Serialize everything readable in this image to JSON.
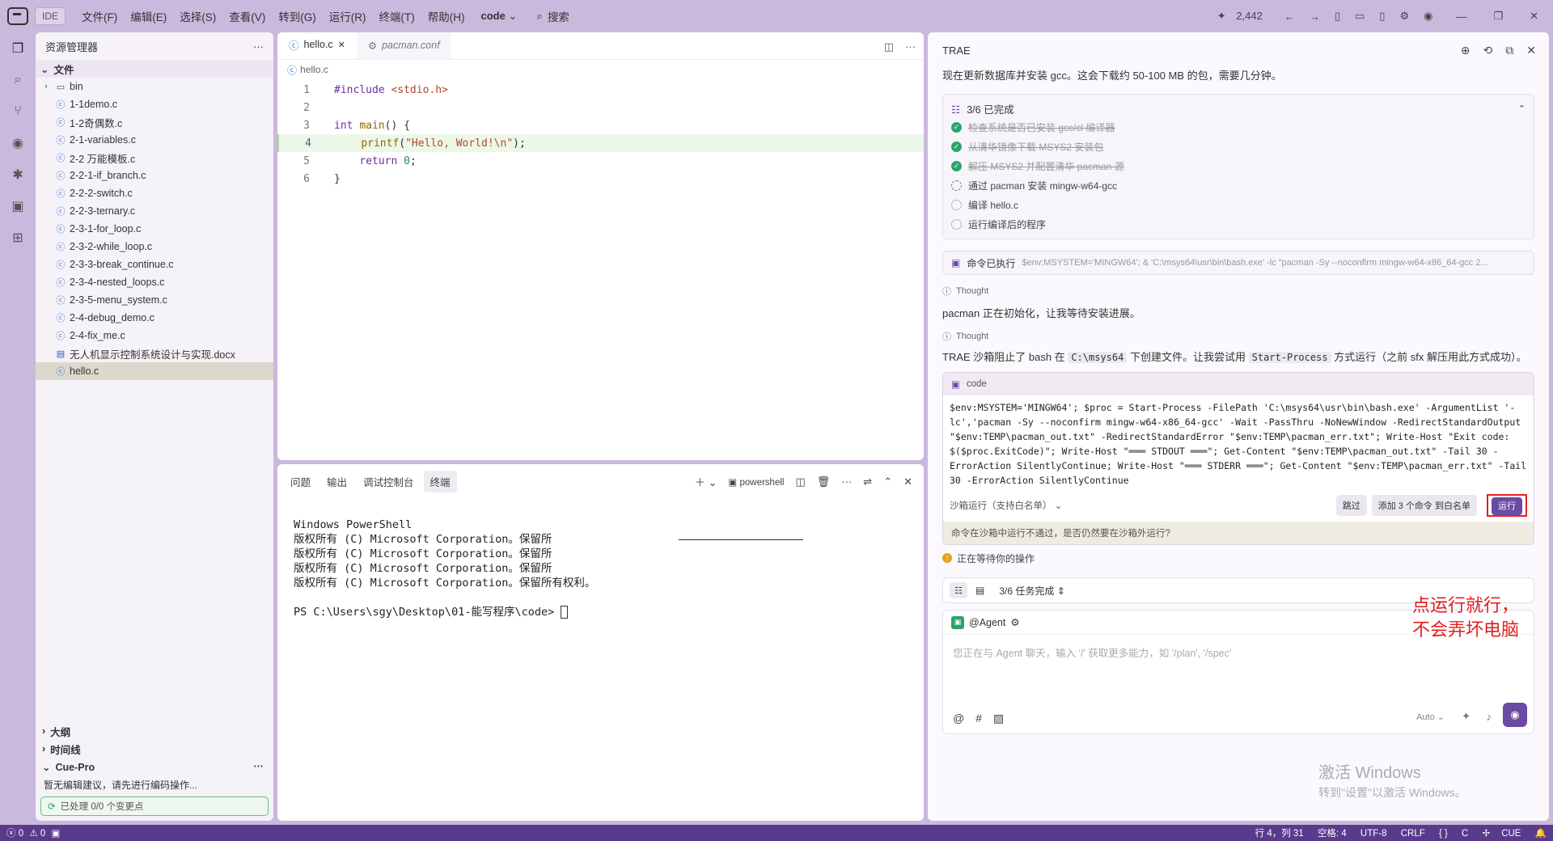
{
  "titlebar": {
    "ide_badge": "IDE",
    "menu": [
      "文件(F)",
      "编辑(E)",
      "选择(S)",
      "查看(V)",
      "转到(G)",
      "运行(R)",
      "终端(T)",
      "帮助(H)"
    ],
    "project": "code",
    "search": "搜索",
    "count": "2,442"
  },
  "explorer": {
    "title": "资源管理器",
    "section": "文件",
    "folder": "bin",
    "files": [
      "1-1demo.c",
      "1-2奇偶数.c",
      "2-1-variables.c",
      "2-2 万能模板.c",
      "2-2-1-if_branch.c",
      "2-2-2-switch.c",
      "2-2-3-ternary.c",
      "2-3-1-for_loop.c",
      "2-3-2-while_loop.c",
      "2-3-3-break_continue.c",
      "2-3-4-nested_loops.c",
      "2-3-5-menu_system.c",
      "2-4-debug_demo.c",
      "2-4-fix_me.c"
    ],
    "docx": "无人机显示控制系统设计与实现.docx",
    "selected_file": "hello.c",
    "outline": "大纲",
    "timeline": "时间线",
    "cue_title": "Cue-Pro",
    "cue_text": "暂无编辑建议，请先进行编码操作...",
    "cue_status": "已处理 0/0 个变更点"
  },
  "editor": {
    "tabs": [
      "hello.c",
      "pacman.conf"
    ],
    "breadcrumb": "hello.c",
    "lines": [
      {
        "n": "1",
        "code": "#include <stdio.h>"
      },
      {
        "n": "2",
        "code": ""
      },
      {
        "n": "3",
        "code": "int main() {"
      },
      {
        "n": "4",
        "code": "    printf(\"Hello, World!\\n\");"
      },
      {
        "n": "5",
        "code": "    return 0;"
      },
      {
        "n": "6",
        "code": "}"
      }
    ]
  },
  "panel": {
    "tabs": [
      "问题",
      "输出",
      "调试控制台",
      "终端"
    ],
    "shell": "powershell",
    "terminal_lines": [
      "Windows PowerShell",
      "版权所有 (C) Microsoft Corporation。保留所",
      "版权所有 (C) Microsoft Corporation。保留所",
      "版权所有 (C) Microsoft Corporation。保留所",
      "版权所有 (C) Microsoft Corporation。保留所有权利。",
      "",
      "PS C:\\Users\\sgy\\Desktop\\01-能写程序\\code> "
    ]
  },
  "chat": {
    "title": "TRAE",
    "intro": "现在更新数据库并安装 gcc。这会下载约 50-100 MB 的包，需要几分钟。",
    "task_progress": "3/6 已完成",
    "tasks": [
      {
        "text": "检查系统是否已安装 gcc/cl 编译器",
        "state": "done"
      },
      {
        "text": "从清华镜像下载 MSYS2 安装包",
        "state": "done"
      },
      {
        "text": "解压 MSYS2 并配置清华 pacman 源",
        "state": "done"
      },
      {
        "text": "通过 pacman 安装 mingw-w64-gcc",
        "state": "running"
      },
      {
        "text": "编译 hello.c",
        "state": "todo"
      },
      {
        "text": "运行编译后的程序",
        "state": "todo"
      }
    ],
    "cmd_done_label": "命令已执行",
    "cmd_done_detail": "$env:MSYSTEM='MINGW64'; & 'C:\\msys64\\usr\\bin\\bash.exe' -lc \"pacman -Sy --noconfirm mingw-w64-x86_64-gcc 2...",
    "thought_label": "Thought",
    "msg1": "pacman 正在初始化，让我等待安装进展。",
    "msg2_a": "TRAE 沙箱阻止了 bash 在",
    "msg2_code1": "C:\\msys64",
    "msg2_b": "下创建文件。让我尝试用",
    "msg2_code2": "Start-Process",
    "msg2_c": "方式运行（之前 sfx 解压用此方式成功）。",
    "code_label": "code",
    "code_body": "$env:MSYSTEM='MINGW64'; $proc = Start-Process -FilePath 'C:\\msys64\\usr\\bin\\bash.exe' -ArgumentList '-lc','pacman -Sy --noconfirm mingw-w64-x86_64-gcc' -Wait -PassThru -NoNewWindow -RedirectStandardOutput \"$env:TEMP\\pacman_out.txt\" -RedirectStandardError \"$env:TEMP\\pacman_err.txt\"; Write-Host \"Exit code: $($proc.ExitCode)\"; Write-Host \"═══ STDOUT ═══\"; Get-Content \"$env:TEMP\\pacman_out.txt\" -Tail 30 -ErrorAction SilentlyContinue; Write-Host \"═══ STDERR ═══\"; Get-Content \"$env:TEMP\\pacman_err.txt\" -Tail 30 -ErrorAction SilentlyContinue",
    "sandbox_label": "沙箱运行（支持白名单）",
    "skip_btn": "跳过",
    "whitelist_btn": "添加 3 个命令 到白名单",
    "run_btn": "运行",
    "warn_text": "命令在沙箱中运行不通过，是否仍然要在沙箱外运行?",
    "waiting": "正在等待你的操作",
    "annotation_line1": "点运行就行，",
    "annotation_line2": "不会弄坏电脑",
    "task_summary": "3/6 任务完成",
    "agent_tag": "@Agent",
    "input_placeholder": "您正在与 Agent 聊天，输入 '/' 获取更多能力，如 '/plan', '/spec'",
    "mode": "Auto",
    "watermark_1": "激活 Windows",
    "watermark_2": "转到\"设置\"以激活 Windows。"
  },
  "statusbar": {
    "left_errors": "0",
    "left_warnings": "0",
    "position": "行 4，列 31",
    "spaces": "空格: 4",
    "encoding": "UTF-8",
    "eol": "CRLF",
    "brackets": "{ }",
    "lang": "C",
    "cue": "CUE"
  }
}
